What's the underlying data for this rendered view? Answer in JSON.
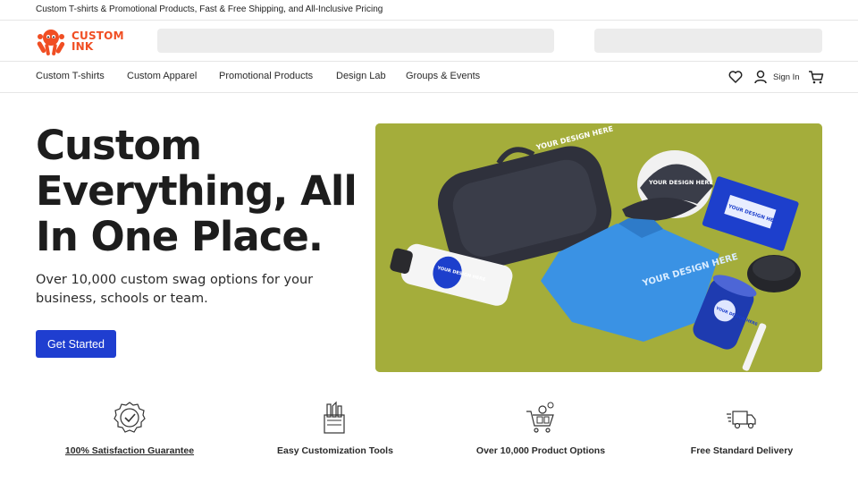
{
  "announcement": "Custom T-shirts & Promotional Products, Fast & Free Shipping, and All-Inclusive Pricing",
  "brand": {
    "line1": "CUSTOM",
    "line2": "INK",
    "color": "#f04e23"
  },
  "nav": {
    "items": [
      "Custom T-shirts",
      "Custom Apparel",
      "Promotional Products",
      "Design Lab",
      "Groups & Events"
    ],
    "sign_in": "Sign In",
    "icons": [
      "heart-icon",
      "user-icon",
      "cart-icon"
    ]
  },
  "hero": {
    "title_lines": [
      "Custom",
      "Everything, All",
      "In One Place."
    ],
    "subtitle": "Over 10,000 custom swag options for your business, schools or team.",
    "cta": "Get Started",
    "cta_color": "#1f3ed0",
    "image_text": {
      "bag": "YOUR DESIGN HERE",
      "hat": "YOUR DESIGN HERE",
      "notebook": "YOUR DESIGN HERE",
      "shirt": "YOUR DESIGN HERE",
      "bottle": "YOUR DESIGN HERE",
      "tumbler": "YOUR DESIGN HERE"
    }
  },
  "features": [
    {
      "label": "100% Satisfaction Guarantee",
      "icon": "badge-check-icon"
    },
    {
      "label": "Easy Customization Tools",
      "icon": "design-tools-icon"
    },
    {
      "label": "Over 10,000 Product Options",
      "icon": "shopping-cart-icon"
    },
    {
      "label": "Free Standard Delivery",
      "icon": "delivery-truck-icon"
    }
  ]
}
